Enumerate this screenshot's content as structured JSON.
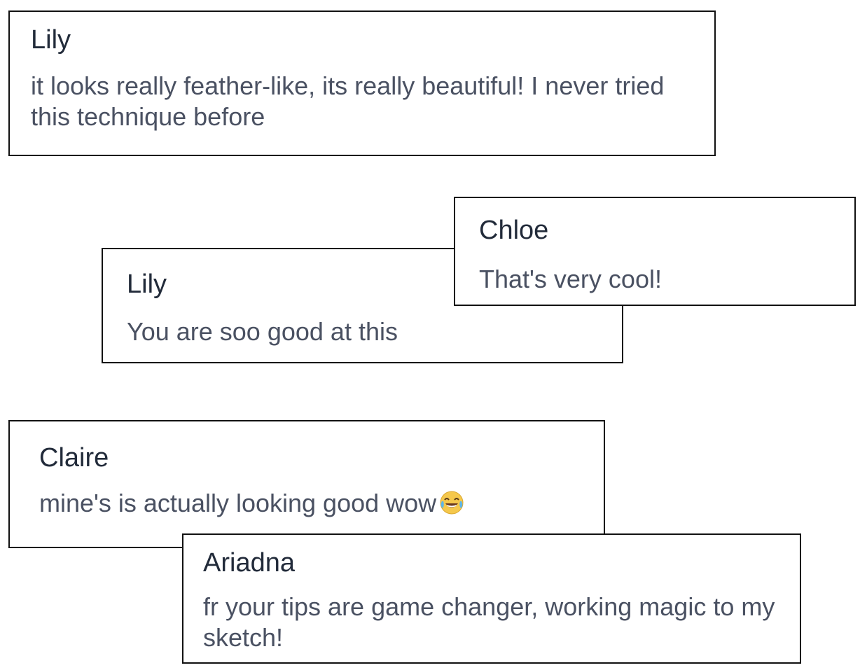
{
  "comments": [
    {
      "author": "Lily",
      "text": "it looks really feather-like, its really beautiful! I never tried this technique before"
    },
    {
      "author": "Lily",
      "text": "You are soo good at this"
    },
    {
      "author": "Chloe",
      "text": "That's very cool!"
    },
    {
      "author": "Claire",
      "text": "mine's is actually looking good wow",
      "emoji": "tears-of-joy-emoji"
    },
    {
      "author": "Ariadna",
      "text": "fr your tips are game changer, working magic to my sketch!"
    }
  ]
}
